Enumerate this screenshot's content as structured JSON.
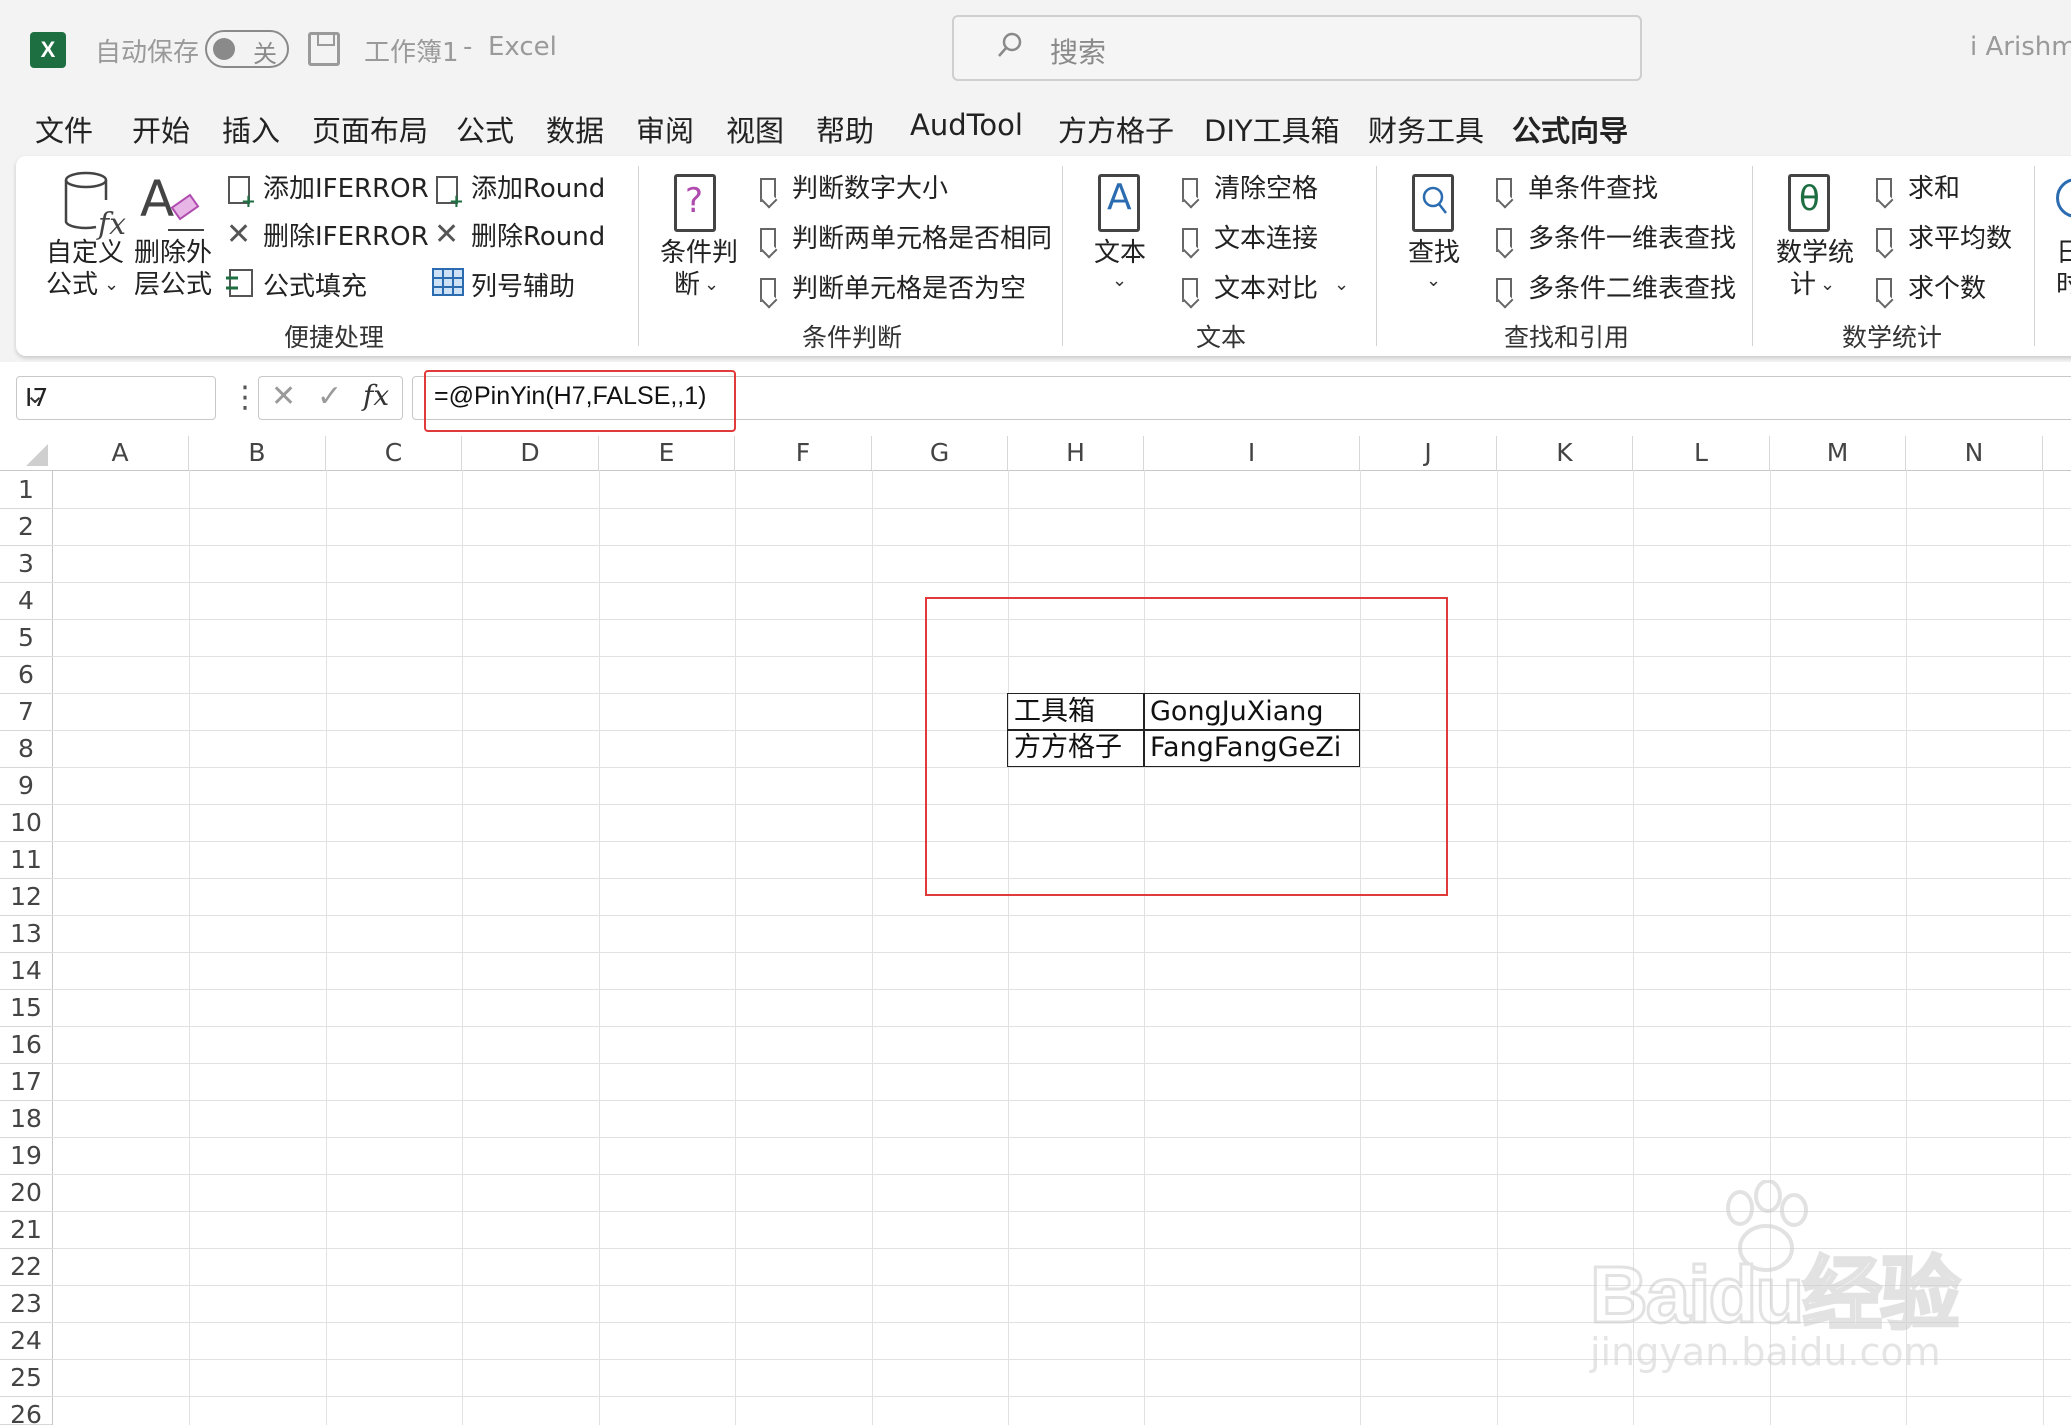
{
  "titlebar": {
    "app_icon": "X",
    "autosave_label": "自动保存",
    "autosave_state": "关",
    "doc_title": "工作簿1",
    "separator": "-",
    "app_name": "Excel",
    "search_placeholder": "搜索",
    "user": "i Arishmi"
  },
  "tabs": [
    "文件",
    "开始",
    "插入",
    "页面布局",
    "公式",
    "数据",
    "审阅",
    "视图",
    "帮助",
    "AudTool",
    "方方格子",
    "DIY工具箱",
    "财务工具",
    "公式向导"
  ],
  "active_tab": "公式向导",
  "ribbon": {
    "g1": {
      "big1_a": "自定义",
      "big1_b": "公式",
      "big2_a": "删除外",
      "big2_b": "层公式",
      "btn1": "添加IFERROR",
      "btn2": "删除IFERROR",
      "btn3": "公式填充",
      "btn4": "添加Round",
      "btn5": "删除Round",
      "btn6": "列号辅助",
      "label": "便捷处理"
    },
    "g2": {
      "big_a": "条件判",
      "big_b": "断",
      "btn1": "判断数字大小",
      "btn2": "判断两单元格是否相同",
      "btn3": "判断单元格是否为空",
      "label": "条件判断"
    },
    "g3": {
      "big": "文本",
      "btn1": "清除空格",
      "btn2": "文本连接",
      "btn3": "文本对比",
      "label": "文本"
    },
    "g4": {
      "big": "查找",
      "btn1": "单条件查找",
      "btn2": "多条件一维表查找",
      "btn3": "多条件二维表查找",
      "label": "查找和引用"
    },
    "g5": {
      "big_a": "数学统",
      "big_b": "计",
      "btn1": "求和",
      "btn2": "求平均数",
      "btn3": "求个数",
      "label": "数学统计"
    },
    "g6": {
      "big_a": "日",
      "big_b": "时"
    }
  },
  "formula_bar": {
    "name_box": "I7",
    "fx_label": "fx",
    "formula": "=@PinYin(H7,FALSE,,1)"
  },
  "columns": [
    "A",
    "B",
    "C",
    "D",
    "E",
    "F",
    "G",
    "H",
    "I",
    "J",
    "K",
    "L",
    "M",
    "N"
  ],
  "rows": [
    "1",
    "2",
    "3",
    "4",
    "5",
    "6",
    "7",
    "8",
    "9",
    "10",
    "11",
    "12",
    "13",
    "14",
    "15",
    "16",
    "17",
    "18",
    "19",
    "20",
    "21",
    "22",
    "23",
    "24",
    "25",
    "26"
  ],
  "cells": {
    "H7": "工具箱",
    "I7": "GongJuXiang",
    "H8": "方方格子",
    "I8": "FangFangGeZi"
  },
  "watermark": {
    "brand": "Baidu经验",
    "url": "jingyan.baidu.com"
  },
  "colors": {
    "excel_green": "#1d6f42",
    "highlight_red": "#e03a3a"
  }
}
